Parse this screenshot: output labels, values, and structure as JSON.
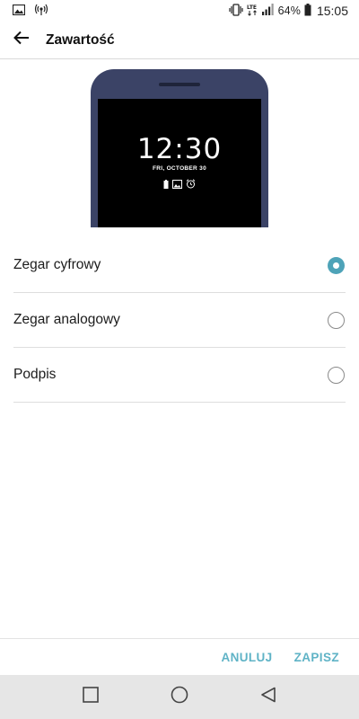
{
  "status_bar": {
    "battery_percent": "64%",
    "time": "15:05",
    "icons": [
      "gallery-icon",
      "hotspot-icon",
      "vibrate-icon",
      "lte-icon",
      "signal-icon",
      "battery-icon"
    ]
  },
  "app_bar": {
    "title": "Zawartość",
    "back_icon": "arrow-left-icon"
  },
  "preview": {
    "time": "12:30",
    "date": "FRI, OCTOBER 30",
    "icons": [
      "battery-icon",
      "gallery-icon",
      "alarm-icon"
    ]
  },
  "options": [
    {
      "label": "Zegar cyfrowy",
      "selected": true
    },
    {
      "label": "Zegar analogowy",
      "selected": false
    },
    {
      "label": "Podpis",
      "selected": false
    }
  ],
  "actions": {
    "cancel": "ANULUJ",
    "save": "ZAPISZ"
  },
  "nav_bar": {
    "icons": [
      "recents-square-icon",
      "home-circle-icon",
      "back-triangle-icon"
    ]
  },
  "colors": {
    "accent": "#5fb3c6",
    "radio_selected": "#4ea3b8",
    "phone_frame": "#3b4366",
    "nav_background": "#e6e6e6"
  }
}
